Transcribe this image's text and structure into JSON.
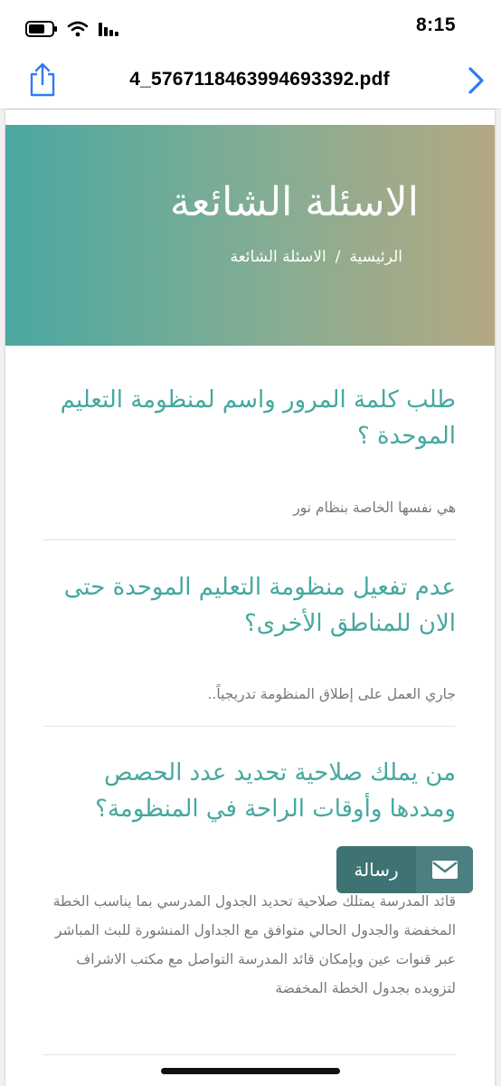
{
  "status_bar": {
    "time": "8:15",
    "icons": [
      "battery-icon",
      "wifi-icon",
      "signal-icon"
    ]
  },
  "viewer": {
    "file_name": "4_5767118463994693392.pdf",
    "share_icon": "share-icon",
    "next_icon": "chevron-right-icon",
    "accent_color": "#2f7bf5"
  },
  "page": {
    "hero": {
      "title": "الاسئلة الشائعة",
      "breadcrumb": {
        "home": "الرئيسية",
        "separator": "/",
        "current": "الاسئلة الشائعة"
      },
      "gradient_start": "#4aa8a1",
      "gradient_end": "#b4a882"
    },
    "faq": [
      {
        "question": "طلب كلمة المرور واسم لمنظومة التعليم الموحدة ؟",
        "answer": "هي نفسها الخاصة بنظام نور"
      },
      {
        "question": "عدم تفعيل منظومة التعليم الموحدة حتى الان للمناطق الأخرى؟",
        "answer": "جاري العمل على إطلاق المنظومة تدريجياً.."
      },
      {
        "question": "من يملك صلاحية تحديد عدد الحصص ومددها وأوقات الراحة في المنظومة؟",
        "answer": "قائد المدرسة يمتلك صلاحية تحديد الجدول المدرسي بما يناسب الخطة المخفضة والجدول الحالي متوافق مع الجداول المنشورة للبث المباشر عبر قنوات عين وبإمكان قائد المدرسة التواصل مع مكتب الاشراف لتزويده بجدول الخطة المخفضة"
      }
    ],
    "question_color": "#45a89f",
    "answer_color": "#777777",
    "message_button": {
      "label": "رسالة",
      "icon": "envelope-icon",
      "color": "#3f7273"
    }
  }
}
